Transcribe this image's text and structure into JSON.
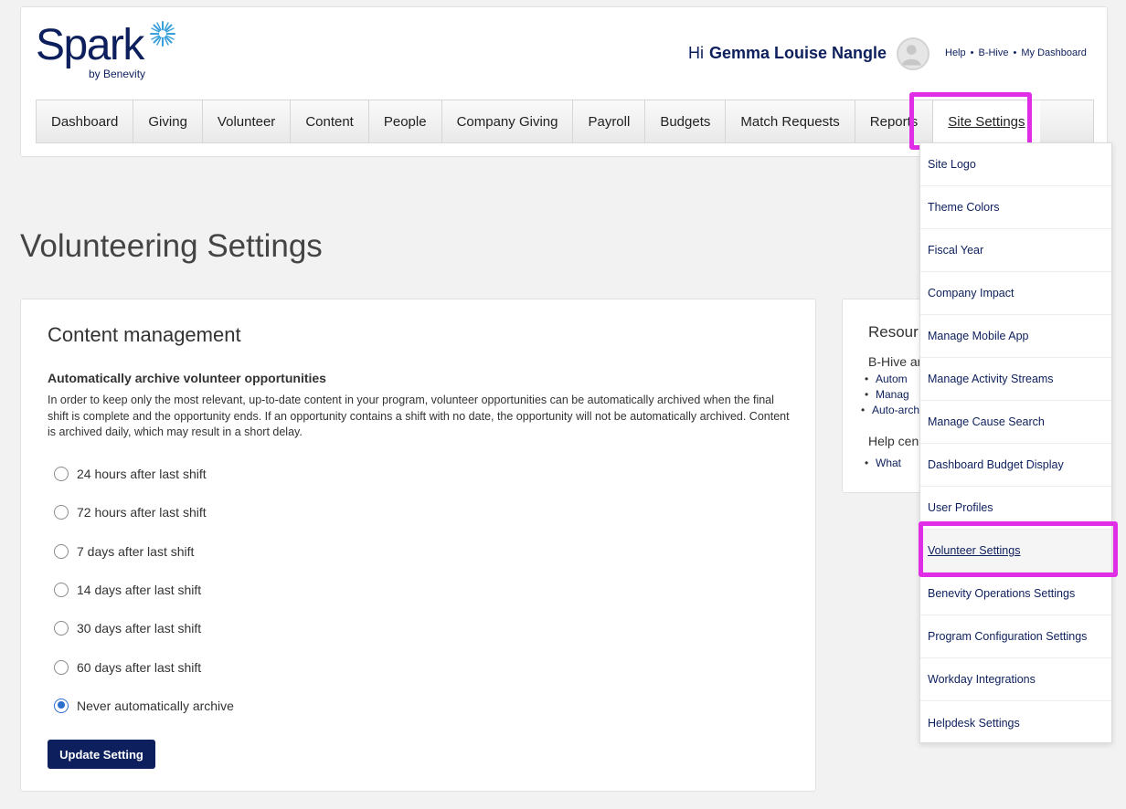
{
  "brand": {
    "name": "Spark",
    "sub": "by Benevity",
    "color": "#0d1f5c"
  },
  "user": {
    "greeting": "Hi",
    "name": "Gemma Louise Nangle"
  },
  "top_links": [
    "Help",
    "•",
    "B-Hive",
    "•",
    "My Dashboard"
  ],
  "nav": {
    "items": [
      "Dashboard",
      "Giving",
      "Volunteer",
      "Content",
      "People",
      "Company Giving",
      "Payroll",
      "Budgets",
      "Match Requests",
      "Reports",
      "Site Settings"
    ],
    "active": "Site Settings"
  },
  "page": {
    "title": "Volunteering Settings"
  },
  "content": {
    "heading": "Content management",
    "subheading": "Automatically archive volunteer opportunities",
    "description": "In order to keep only the most relevant, up-to-date content in your program, volunteer opportunities can be automatically archived when the final shift is complete and the opportunity ends. If an opportunity contains a shift with no date, the opportunity will not be automatically archived. Content is archived daily, which may result in a short delay.",
    "options": [
      "24 hours after last shift",
      "72 hours after last shift",
      "7 days after last shift",
      "14 days after last shift",
      "30 days after last shift",
      "60 days after last shift",
      "Never automatically archive"
    ],
    "selected_index": 6,
    "button": "Update Setting"
  },
  "resources": {
    "title": "Resour",
    "line1": "B-Hive ar",
    "bullets": [
      "Autom",
      "Manag"
    ],
    "extra": "Auto-arch",
    "line2": "Help cen",
    "bullet2": "What"
  },
  "dropdown": {
    "items": [
      "Site Logo",
      "Theme Colors",
      "Fiscal Year",
      "Company Impact",
      "Manage Mobile App",
      "Manage Activity Streams",
      "Manage Cause Search",
      "Dashboard Budget Display",
      "User Profiles",
      "Volunteer Settings",
      "Benevity Operations Settings",
      "Program Configuration Settings",
      "Workday Integrations",
      "Helpdesk Settings"
    ],
    "active_index": 9
  },
  "highlight_color": "#e02de6"
}
